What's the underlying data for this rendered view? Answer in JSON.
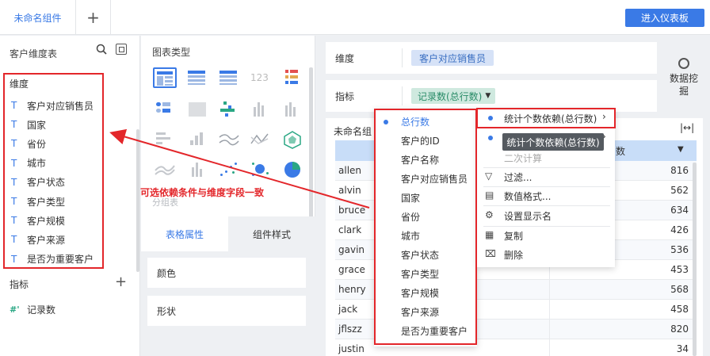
{
  "topbar": {
    "tab_label": "未命名组件",
    "add_tab_symbol": "+",
    "enter_button": "进入仪表板"
  },
  "left_panel": {
    "title": "客户维度表",
    "dimension_header": "维度",
    "dimensions": [
      "客户对应销售员",
      "国家",
      "省份",
      "城市",
      "客户状态",
      "客户类型",
      "客户规模",
      "客户来源",
      "是否为重要客户"
    ],
    "dim_type_glyph": "T",
    "index_header": "指标",
    "index_add_symbol": "+",
    "index_glyph": "#'",
    "indices": [
      "记录数"
    ]
  },
  "middle_panel": {
    "title": "图表类型",
    "chart_icon_text": "123",
    "group_label": "分组表",
    "tabs": [
      "表格属性",
      "组件样式"
    ],
    "props": [
      "颜色",
      "形状"
    ]
  },
  "right_panel": {
    "dimension_label": "维度",
    "dimension_value": "客户对应销售员",
    "index_label": "指标",
    "index_value": "记录数(总行数)",
    "mining_label": "数据挖掘",
    "table_title": "未命名组",
    "resize_glyph": "|↔|",
    "header_value_col": "数",
    "rows": [
      {
        "name": "allen",
        "value": "816"
      },
      {
        "name": "alvin",
        "value": "562"
      },
      {
        "name": "bruce",
        "value": "634"
      },
      {
        "name": "clark",
        "value": "426"
      },
      {
        "name": "gavin",
        "value": "536"
      },
      {
        "name": "grace",
        "value": "453"
      },
      {
        "name": "henry",
        "value": "568"
      },
      {
        "name": "jack",
        "value": "458"
      },
      {
        "name": "jflszz",
        "value": "820"
      },
      {
        "name": "justin",
        "value": "34"
      }
    ]
  },
  "dropdown_list": {
    "items": [
      "总行数",
      "客户的ID",
      "客户名称",
      "客户对应销售员",
      "国家",
      "省份",
      "城市",
      "客户状态",
      "客户类型",
      "客户规模",
      "客户来源",
      "是否为重要客户"
    ],
    "selected": "总行数"
  },
  "context_menu": {
    "count_dependency": "统计个数依赖(总行数)",
    "secondary_calc": "二次计算",
    "filter": "过滤...",
    "number_format": "数值格式...",
    "display_name": "设置显示名",
    "copy": "复制",
    "delete": "删除",
    "tooltip": "统计个数依赖(总行数)"
  },
  "annotation": {
    "text": "可选依赖条件与维度字段一致",
    "color": "#e3262a"
  },
  "colors": {
    "accent": "#3a7ae6",
    "dim_pill": "#d6e2f7",
    "index_pill": "#cfe9df",
    "table_header": "#c8ddf8"
  }
}
